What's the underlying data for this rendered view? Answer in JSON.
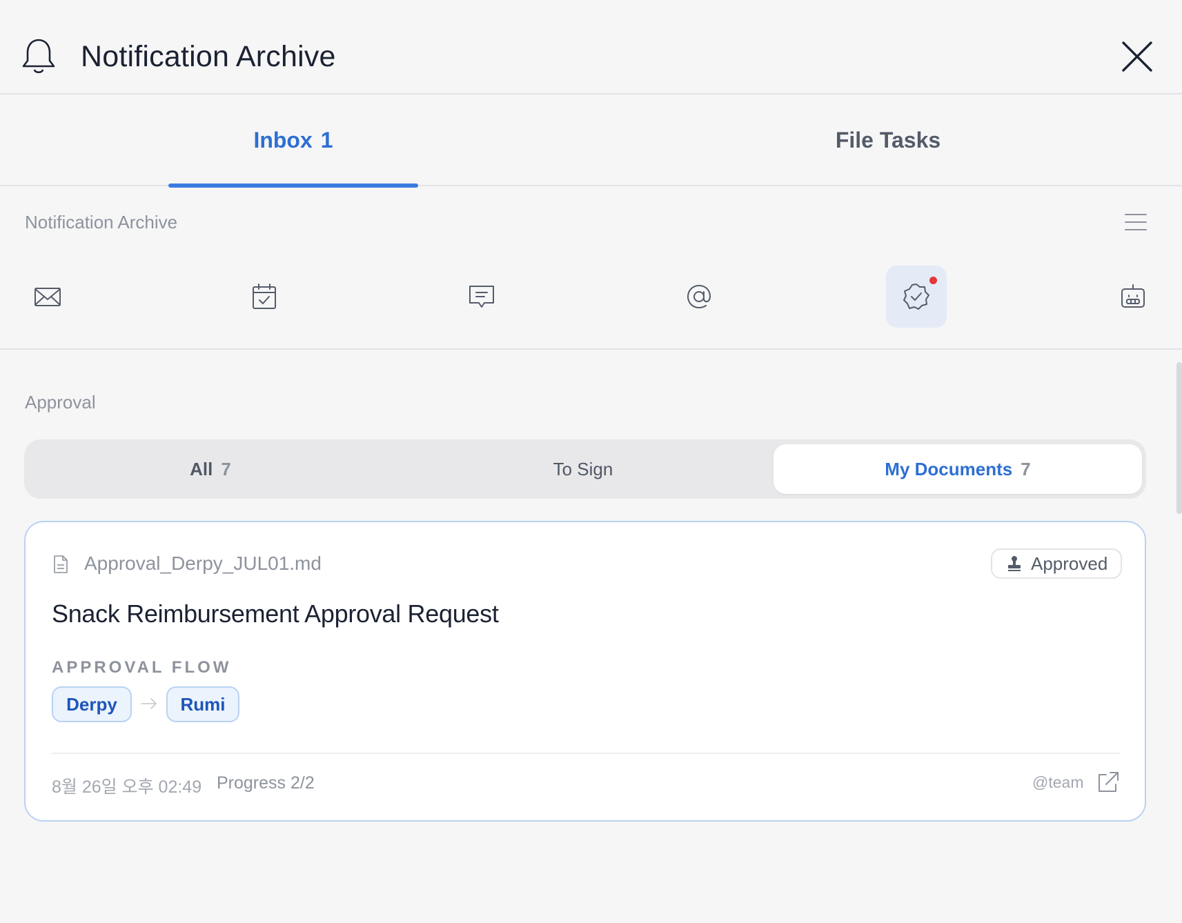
{
  "header": {
    "title": "Notification Archive",
    "bell_icon": "bell-icon",
    "close_icon": "close-icon"
  },
  "tabs": [
    {
      "label": "Inbox",
      "count": "1",
      "active": true
    },
    {
      "label": "File Tasks",
      "active": false
    }
  ],
  "section": {
    "title": "Notification Archive",
    "menu_icon": "menu-icon"
  },
  "categories": [
    {
      "icon": "mail-icon",
      "active": false
    },
    {
      "icon": "calendar-check-icon",
      "active": false
    },
    {
      "icon": "comment-icon",
      "active": false
    },
    {
      "icon": "mention-icon",
      "active": false
    },
    {
      "icon": "approval-badge-icon",
      "active": true,
      "has_unread": true
    },
    {
      "icon": "bot-icon",
      "active": false
    }
  ],
  "approval": {
    "label": "Approval",
    "filters": [
      {
        "label": "All",
        "count": "7"
      },
      {
        "label": "To Sign",
        "count": ""
      },
      {
        "label": "My Documents",
        "count": "7",
        "selected": true
      }
    ]
  },
  "card": {
    "filename": "Approval_Derpy_JUL01.md",
    "status": "Approved",
    "subject": "Snack Reimbursement Approval Request",
    "flow_label": "APPROVAL FLOW",
    "flow": [
      "Derpy",
      "Rumi"
    ],
    "date": "8월 26일 오후 02:49",
    "progress": "Progress 2/2",
    "team": "@team"
  },
  "colors": {
    "accent": "#2d6fd3",
    "unread_dot": "#e5363a",
    "card_border": "#b9d2f3"
  }
}
